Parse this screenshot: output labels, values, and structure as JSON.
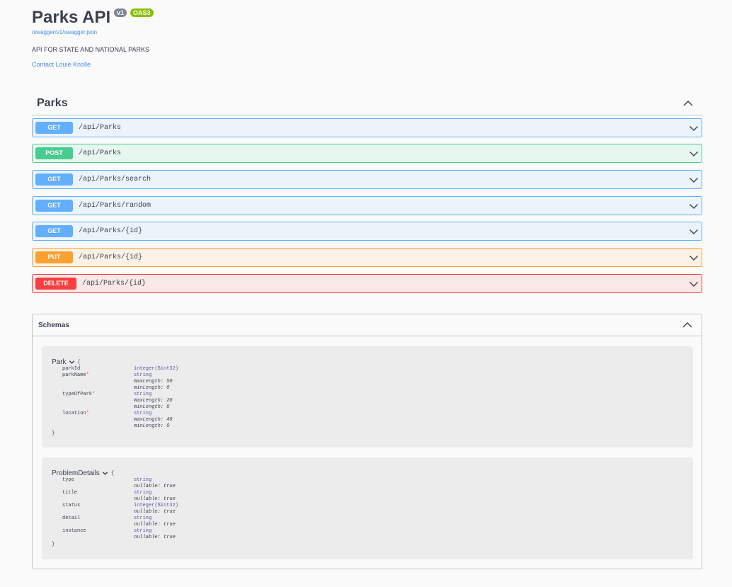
{
  "info": {
    "title": "Parks API",
    "version_badge": "v1",
    "oas_badge": "OAS3",
    "spec_url": "/swagger/v1/swagger.json",
    "description": "API FOR STATE AND NATIONAL PARKS",
    "contact": "Contact Louie Knolle"
  },
  "tag": {
    "name": "Parks"
  },
  "operations": [
    {
      "method": "GET",
      "path": "/api/Parks"
    },
    {
      "method": "POST",
      "path": "/api/Parks"
    },
    {
      "method": "GET",
      "path": "/api/Parks/search"
    },
    {
      "method": "GET",
      "path": "/api/Parks/random"
    },
    {
      "method": "GET",
      "path": "/api/Parks/{id}"
    },
    {
      "method": "PUT",
      "path": "/api/Parks/{id}"
    },
    {
      "method": "DELETE",
      "path": "/api/Parks/{id}"
    }
  ],
  "schemas": {
    "title": "Schemas",
    "models": [
      {
        "name": "Park",
        "open_brace": "{",
        "close_brace": "}",
        "properties": [
          {
            "name": "parkId",
            "required": false,
            "type": "integer($int32)",
            "meta": []
          },
          {
            "name": "parkName",
            "required": true,
            "type": "string",
            "meta": [
              "maxLength: 50",
              "minLength: 0"
            ]
          },
          {
            "name": "typeOfPark",
            "required": true,
            "type": "string",
            "meta": [
              "maxLength: 20",
              "minLength: 0"
            ]
          },
          {
            "name": "location",
            "required": true,
            "type": "string",
            "meta": [
              "maxLength: 40",
              "minLength: 0"
            ]
          }
        ]
      },
      {
        "name": "ProblemDetails",
        "open_brace": "{",
        "close_brace": "}",
        "properties": [
          {
            "name": "type",
            "required": false,
            "type": "string",
            "meta": [
              "nullable: true"
            ]
          },
          {
            "name": "title",
            "required": false,
            "type": "string",
            "meta": [
              "nullable: true"
            ]
          },
          {
            "name": "status",
            "required": false,
            "type": "integer($int32)",
            "meta": [
              "nullable: true"
            ]
          },
          {
            "name": "detail",
            "required": false,
            "type": "string",
            "meta": [
              "nullable: true"
            ]
          },
          {
            "name": "instance",
            "required": false,
            "type": "string",
            "meta": [
              "nullable: true"
            ]
          }
        ]
      }
    ]
  },
  "colors": {
    "get": "#61affe",
    "post": "#49cc90",
    "put": "#fca130",
    "delete": "#f93e3e",
    "link": "#4990e2"
  },
  "icons": {
    "tag_toggle": "chevron-up-icon",
    "op_toggle": "chevron-down-icon",
    "model_toggle": "chevron-down-icon"
  }
}
